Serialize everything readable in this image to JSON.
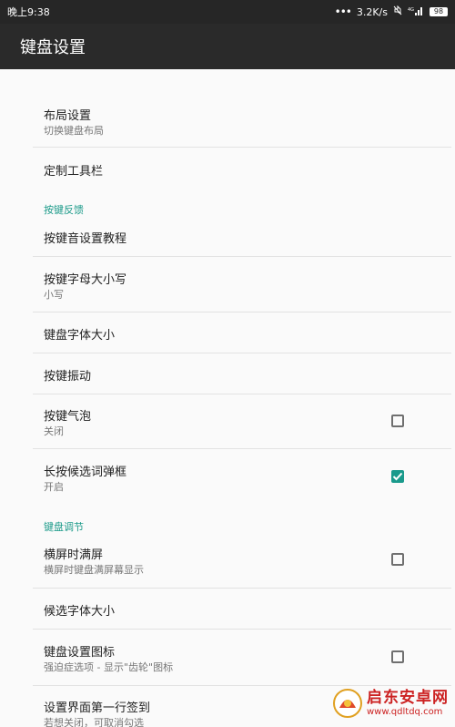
{
  "status_bar": {
    "time": "晚上9:38",
    "network_speed": "3.2K/s",
    "battery": "98",
    "signal_label": "4G"
  },
  "app_bar": {
    "title": "键盘设置"
  },
  "prefs": {
    "layout": {
      "title": "布局设置",
      "summary": "切换键盘布局"
    },
    "toolbar": {
      "title": "定制工具栏"
    },
    "section_feedback": "按键反馈",
    "sound_tutorial": {
      "title": "按键音设置教程"
    },
    "letter_case": {
      "title": "按键字母大小写",
      "summary": "小写"
    },
    "font_size": {
      "title": "键盘字体大小"
    },
    "vibration": {
      "title": "按键振动"
    },
    "popup": {
      "title": "按键气泡",
      "summary": "关闭",
      "checked": false
    },
    "long_press": {
      "title": "长按候选词弹框",
      "summary": "开启",
      "checked": true
    },
    "section_adjust": "键盘调节",
    "fullscreen": {
      "title": "横屏时满屏",
      "summary": "横屏时键盘满屏幕显示",
      "checked": false
    },
    "candidate_font": {
      "title": "候选字体大小"
    },
    "settings_icon": {
      "title": "键盘设置图标",
      "summary": "强迫症选项 - 显示\"齿轮\"图标",
      "checked": false
    },
    "sign_in": {
      "title": "设置界面第一行签到",
      "summary": "若想关闭，可取消勾选"
    }
  },
  "watermark": {
    "name": "启东安卓网",
    "url": "www.qdltdq.com"
  },
  "colors": {
    "accent": "#1a9a8c",
    "app_bar": "#2a2a2a",
    "status_bar": "#262626",
    "background": "#fafafa"
  }
}
